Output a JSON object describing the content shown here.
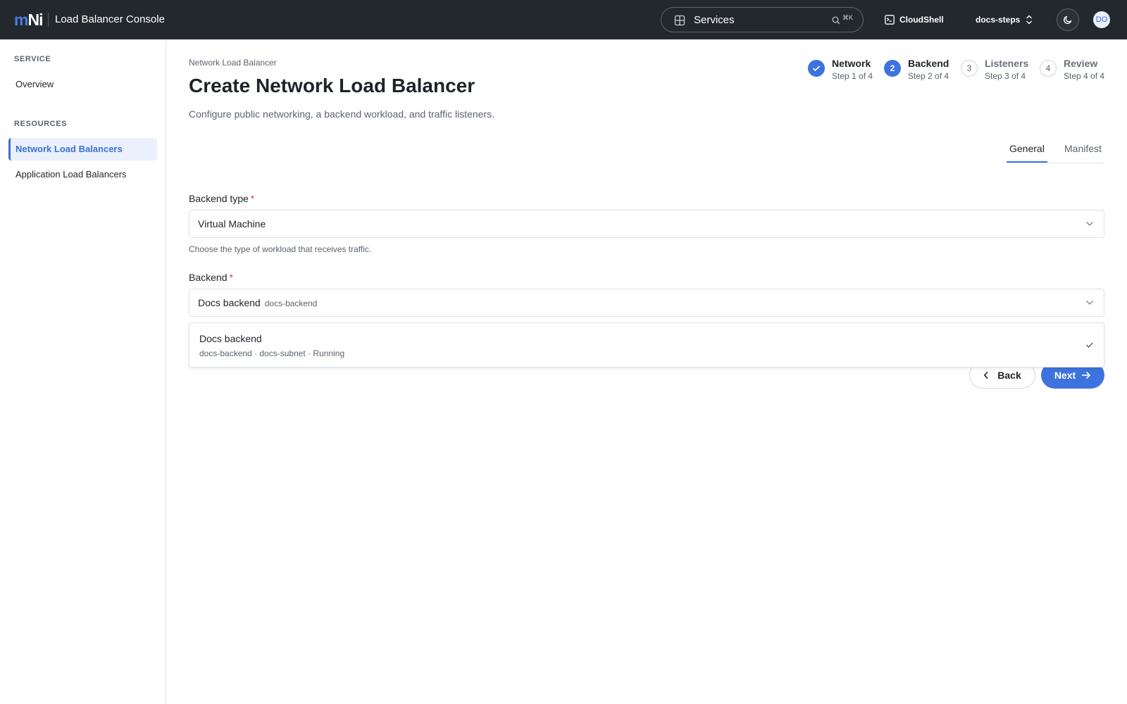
{
  "topbar": {
    "logo_m": "m",
    "logo_ni": "Ni",
    "app_title": "Load Balancer Console",
    "search_label": "Services",
    "search_shortcut": "⌘K",
    "cloudshell_label": "CloudShell",
    "project_label": "docs-steps",
    "avatar_initials": "DO"
  },
  "sidebar": {
    "sections": [
      {
        "heading": "SERVICE",
        "items": [
          {
            "label": "Overview",
            "active": false
          }
        ]
      },
      {
        "heading": "RESOURCES",
        "items": [
          {
            "label": "Network Load Balancers",
            "active": true
          },
          {
            "label": "Application Load Balancers",
            "active": false
          }
        ]
      }
    ]
  },
  "page": {
    "breadcrumb": "Network Load Balancer",
    "title": "Create Network Load Balancer",
    "description": "Configure public networking, a backend workload, and traffic listeners."
  },
  "stepper": [
    {
      "number": "1",
      "name": "Network",
      "sub": "Step 1 of 4",
      "state": "done"
    },
    {
      "number": "2",
      "name": "Backend",
      "sub": "Step 2 of 4",
      "state": "current"
    },
    {
      "number": "3",
      "name": "Listeners",
      "sub": "Step 3 of 4",
      "state": "todo"
    },
    {
      "number": "4",
      "name": "Review",
      "sub": "Step 4 of 4",
      "state": "todo"
    }
  ],
  "tabs": [
    {
      "label": "General",
      "active": true
    },
    {
      "label": "Manifest",
      "active": false
    }
  ],
  "form": {
    "backend_type": {
      "label": "Backend type",
      "required_mark": "*",
      "value": "Virtual Machine",
      "help": "Choose the type of workload that receives traffic."
    },
    "backend": {
      "label": "Backend",
      "required_mark": "*",
      "value": "Docs backend",
      "value_sub": "docs-backend",
      "options": [
        {
          "title": "Docs backend",
          "detail": "docs-backend · docs-subnet · Running",
          "selected": true
        }
      ]
    }
  },
  "actions": {
    "back_label": "Back",
    "next_label": "Next"
  },
  "colors": {
    "accent": "#3d73de",
    "topbar_bg": "#23272e",
    "required": "#d64545"
  }
}
